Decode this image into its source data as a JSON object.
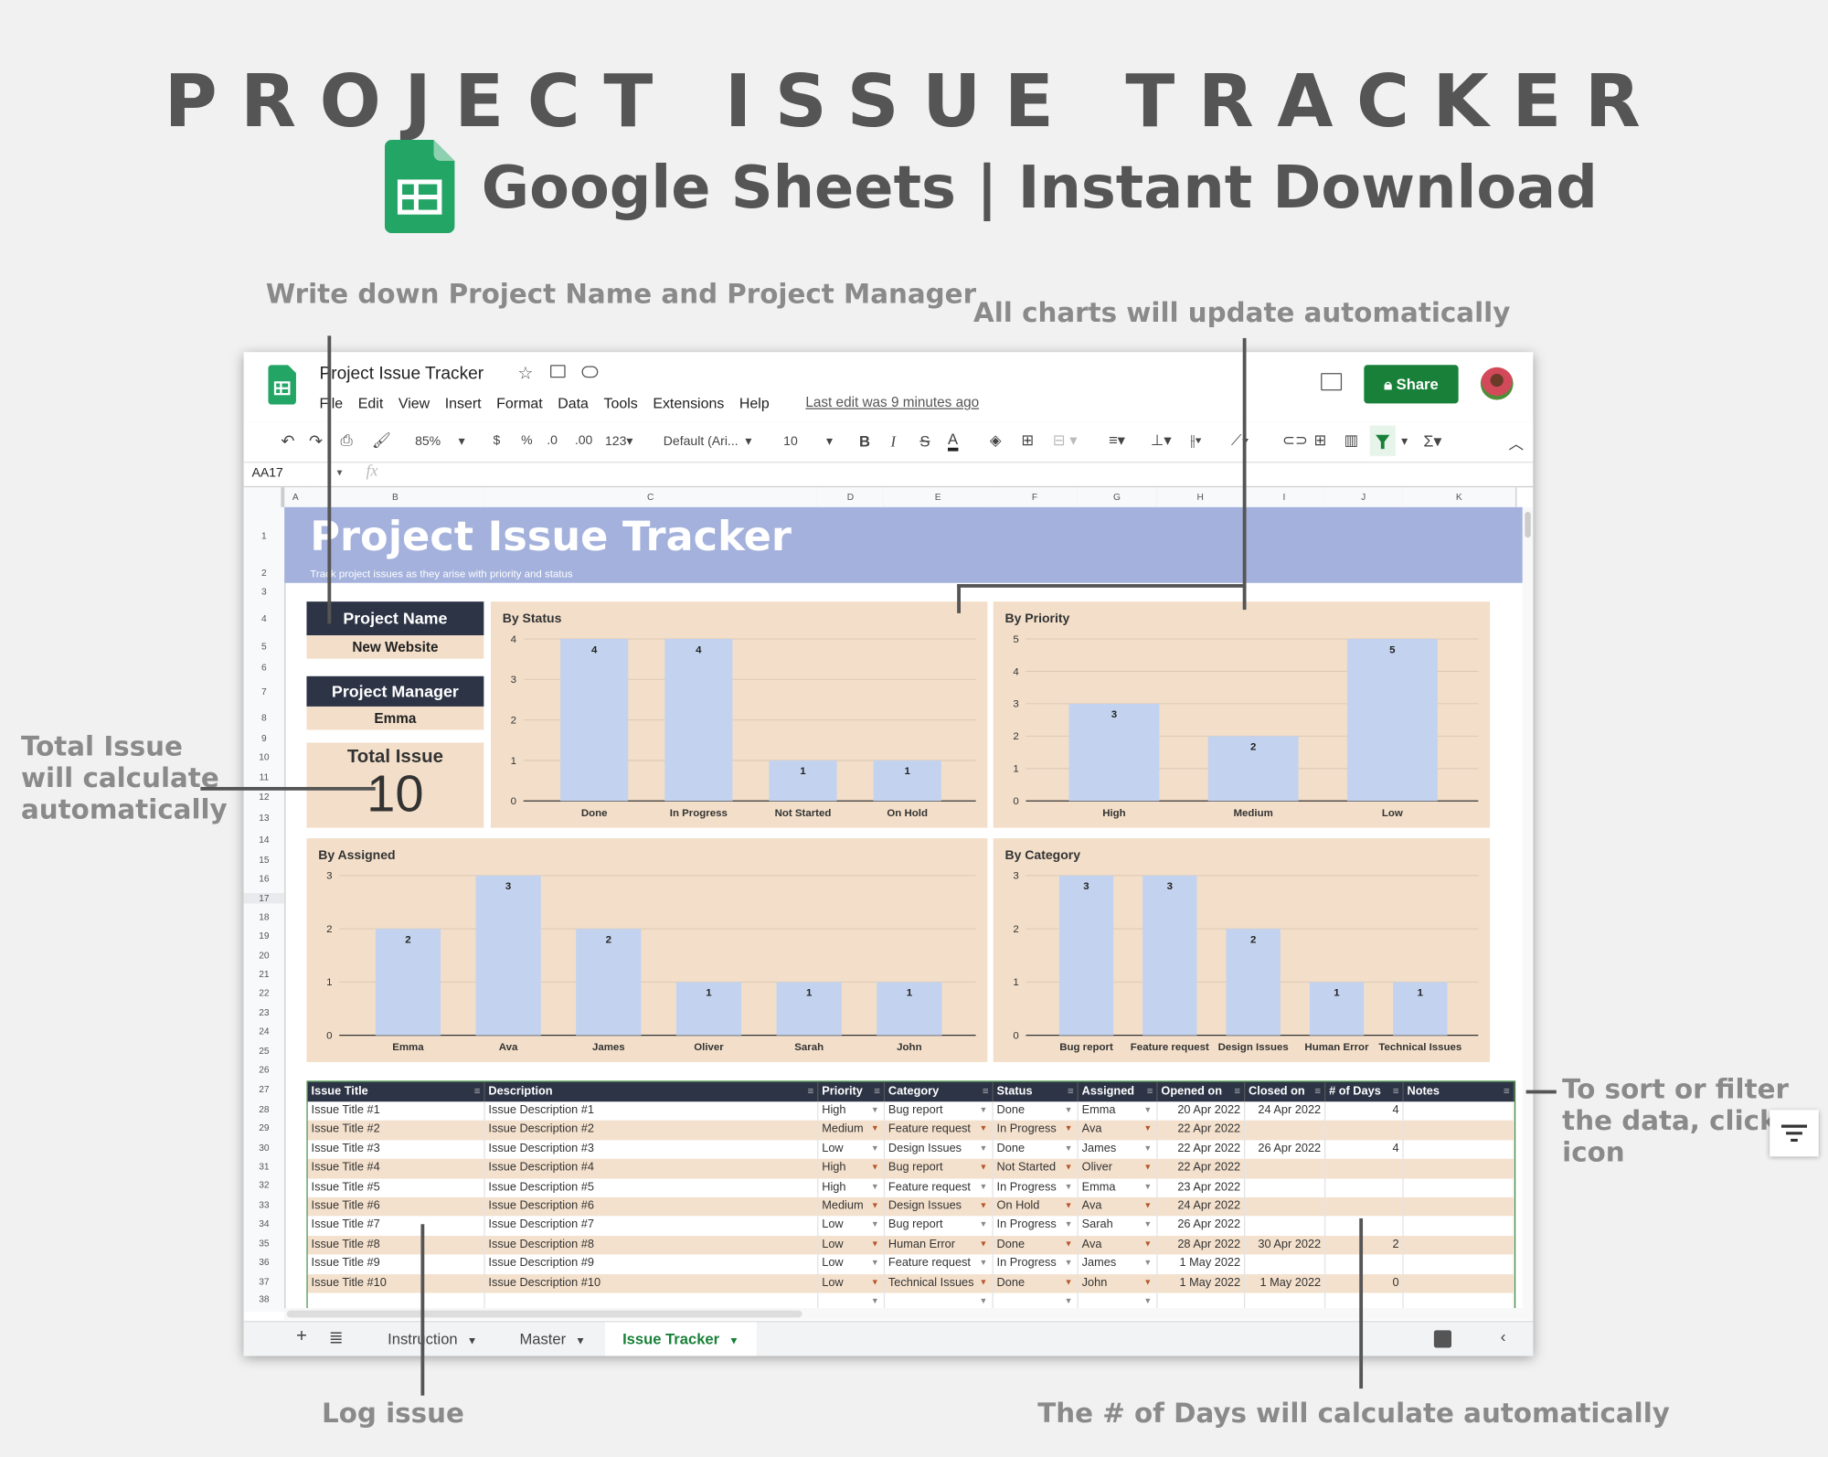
{
  "promo": {
    "title": "PROJECT ISSUE TRACKER",
    "subtitle": "Google Sheets | Instant Download",
    "notes": {
      "project": "Write down Project Name and Project Manager",
      "charts": "All charts will update automatically",
      "total": "Total Issue will calculate automatically",
      "sort": "To sort or filter the data, click icon",
      "log": "Log issue",
      "days": "The # of Days will calculate automatically"
    }
  },
  "app": {
    "doc_title": "Project Issue Tracker",
    "menu": [
      "File",
      "Edit",
      "View",
      "Insert",
      "Format",
      "Data",
      "Tools",
      "Extensions",
      "Help"
    ],
    "last_edit": "Last edit was 9 minutes ago",
    "share": "Share",
    "toolbar": {
      "zoom": "85%",
      "currency": "$",
      "percent": "%",
      "dec_less": ".0",
      "dec_more": ".00",
      "format": "123",
      "font": "Default (Ari...",
      "size": "10",
      "bold": "B",
      "italic": "I",
      "strike": "S",
      "text_color": "A",
      "sum": "Σ"
    },
    "cell_ref": "AA17",
    "fx": "fx",
    "columns": [
      "A",
      "B",
      "C",
      "D",
      "E",
      "F",
      "G",
      "H",
      "I",
      "J",
      "K"
    ],
    "row_numbers": [
      "1",
      "2",
      "3",
      "4",
      "5",
      "6",
      "7",
      "8",
      "9",
      "10",
      "11",
      "12",
      "13",
      "14",
      "15",
      "16",
      "17",
      "18",
      "19",
      "20",
      "21",
      "22",
      "23",
      "24",
      "25",
      "26",
      "27",
      "28",
      "29",
      "30",
      "31",
      "32",
      "33",
      "34",
      "35",
      "36",
      "37",
      "38"
    ],
    "sheet_tabs": [
      {
        "label": "Instruction"
      },
      {
        "label": "Master"
      },
      {
        "label": "Issue Tracker",
        "active": true
      }
    ],
    "colors": {
      "accent": "#188038",
      "banner": "#a3b1dc",
      "header_dark": "#2d3446",
      "beige": "#f3dfc9",
      "bar": "#c3d3ef"
    }
  },
  "sheet": {
    "banner_title": "Project Issue Tracker",
    "banner_subtitle": "Track project issues as they arise with priority and status",
    "project_name_label": "Project Name",
    "project_name": "New Website",
    "project_manager_label": "Project Manager",
    "project_manager": "Emma",
    "total_issue_label": "Total Issue",
    "total_issue": "10"
  },
  "chart_data": [
    {
      "type": "bar",
      "title": "By Status",
      "categories": [
        "Done",
        "In Progress",
        "Not Started",
        "On Hold"
      ],
      "values": [
        4,
        4,
        1,
        1
      ],
      "ylim": [
        0,
        4
      ],
      "ticks": [
        0,
        1,
        2,
        3,
        4
      ]
    },
    {
      "type": "bar",
      "title": "By Priority",
      "categories": [
        "High",
        "Medium",
        "Low"
      ],
      "values": [
        3,
        2,
        5
      ],
      "ylim": [
        0,
        5
      ],
      "ticks": [
        0,
        1,
        2,
        3,
        4,
        5
      ]
    },
    {
      "type": "bar",
      "title": "By Assigned",
      "categories": [
        "Emma",
        "Ava",
        "James",
        "Oliver",
        "Sarah",
        "John"
      ],
      "values": [
        2,
        3,
        2,
        1,
        1,
        1
      ],
      "ylim": [
        0,
        3
      ],
      "ticks": [
        0,
        1,
        2,
        3
      ]
    },
    {
      "type": "bar",
      "title": "By Category",
      "categories": [
        "Bug report",
        "Feature request",
        "Design Issues",
        "Human Error",
        "Technical Issues"
      ],
      "values": [
        3,
        3,
        2,
        1,
        1
      ],
      "ylim": [
        0,
        3
      ],
      "ticks": [
        0,
        1,
        2,
        3
      ]
    }
  ],
  "table": {
    "headers": [
      "Issue Title",
      "Description",
      "Priority",
      "Category",
      "Status",
      "Assigned",
      "Opened on",
      "Closed on",
      "# of Days",
      "Notes"
    ],
    "rows": [
      [
        "Issue Title #1",
        "Issue Description #1",
        "High",
        "Bug report",
        "Done",
        "Emma",
        "20 Apr 2022",
        "24 Apr 2022",
        "4",
        ""
      ],
      [
        "Issue Title #2",
        "Issue Description #2",
        "Medium",
        "Feature request",
        "In Progress",
        "Ava",
        "22 Apr 2022",
        "",
        "",
        ""
      ],
      [
        "Issue Title #3",
        "Issue Description #3",
        "Low",
        "Design Issues",
        "Done",
        "James",
        "22 Apr 2022",
        "26 Apr 2022",
        "4",
        ""
      ],
      [
        "Issue Title #4",
        "Issue Description #4",
        "High",
        "Bug report",
        "Not Started",
        "Oliver",
        "22 Apr 2022",
        "",
        "",
        ""
      ],
      [
        "Issue Title #5",
        "Issue Description #5",
        "High",
        "Feature request",
        "In Progress",
        "Emma",
        "23 Apr 2022",
        "",
        "",
        ""
      ],
      [
        "Issue Title #6",
        "Issue Description #6",
        "Medium",
        "Design Issues",
        "On Hold",
        "Ava",
        "24 Apr 2022",
        "",
        "",
        ""
      ],
      [
        "Issue Title #7",
        "Issue Description #7",
        "Low",
        "Bug report",
        "In Progress",
        "Sarah",
        "26 Apr 2022",
        "",
        "",
        ""
      ],
      [
        "Issue Title #8",
        "Issue Description #8",
        "Low",
        "Human Error",
        "Done",
        "Ava",
        "28 Apr 2022",
        "30 Apr 2022",
        "2",
        ""
      ],
      [
        "Issue Title #9",
        "Issue Description #9",
        "Low",
        "Feature request",
        "In Progress",
        "James",
        "1 May 2022",
        "",
        "",
        ""
      ],
      [
        "Issue Title #10",
        "Issue Description #10",
        "Low",
        "Technical Issues",
        "Done",
        "John",
        "1 May 2022",
        "1 May 2022",
        "0",
        ""
      ],
      [
        "",
        "",
        "",
        "",
        "",
        "",
        "",
        "",
        "",
        ""
      ]
    ]
  }
}
